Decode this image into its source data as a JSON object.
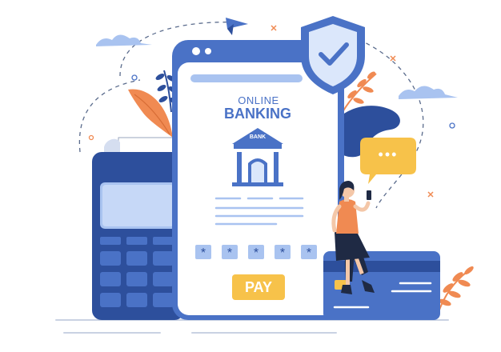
{
  "phone": {
    "title_line1": "ONLINE",
    "title_line2": "BANKING",
    "bank_sign": "BANK",
    "pin_chars": [
      "*",
      "*",
      "*",
      "*",
      "*"
    ],
    "pay_label": "PAY"
  },
  "chat_bubble": {
    "text": "•••"
  },
  "colors": {
    "primary_blue": "#4a72c6",
    "light_blue": "#a9c3f0",
    "dark_blue": "#2d4f9c",
    "orange": "#f08a52",
    "yellow": "#f7c24a",
    "pale_blue": "#dbe7fb"
  }
}
